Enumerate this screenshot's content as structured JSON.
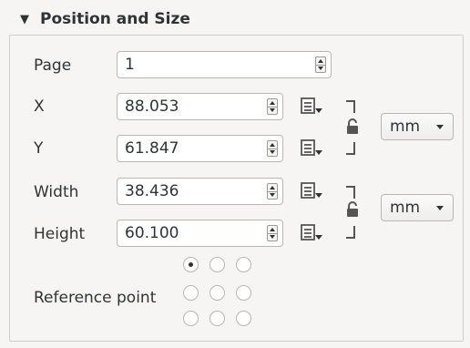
{
  "group": {
    "title": "Position and Size",
    "collapse_icon": "triangle-down-icon"
  },
  "fields": {
    "page": {
      "label": "Page",
      "value": "1"
    },
    "x": {
      "label": "X",
      "value": "88.053"
    },
    "y": {
      "label": "Y",
      "value": "61.847"
    },
    "width": {
      "label": "Width",
      "value": "38.436"
    },
    "height": {
      "label": "Height",
      "value": "60.100"
    }
  },
  "units": {
    "position": "mm",
    "size": "mm"
  },
  "reference_point": {
    "label": "Reference point",
    "selected": "top-left"
  }
}
